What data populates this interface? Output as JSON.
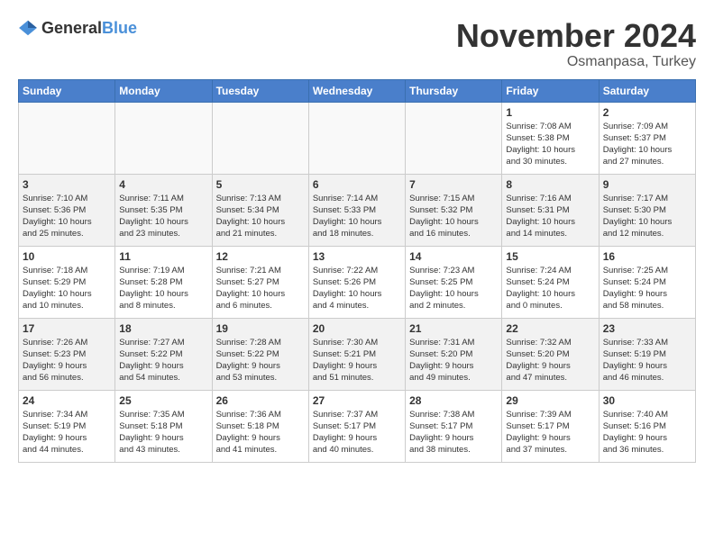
{
  "header": {
    "logo_general": "General",
    "logo_blue": "Blue",
    "month_title": "November 2024",
    "location": "Osmanpasa, Turkey"
  },
  "calendar": {
    "days_of_week": [
      "Sunday",
      "Monday",
      "Tuesday",
      "Wednesday",
      "Thursday",
      "Friday",
      "Saturday"
    ],
    "weeks": [
      [
        {
          "day": "",
          "info": ""
        },
        {
          "day": "",
          "info": ""
        },
        {
          "day": "",
          "info": ""
        },
        {
          "day": "",
          "info": ""
        },
        {
          "day": "",
          "info": ""
        },
        {
          "day": "1",
          "info": "Sunrise: 7:08 AM\nSunset: 5:38 PM\nDaylight: 10 hours\nand 30 minutes."
        },
        {
          "day": "2",
          "info": "Sunrise: 7:09 AM\nSunset: 5:37 PM\nDaylight: 10 hours\nand 27 minutes."
        }
      ],
      [
        {
          "day": "3",
          "info": "Sunrise: 7:10 AM\nSunset: 5:36 PM\nDaylight: 10 hours\nand 25 minutes."
        },
        {
          "day": "4",
          "info": "Sunrise: 7:11 AM\nSunset: 5:35 PM\nDaylight: 10 hours\nand 23 minutes."
        },
        {
          "day": "5",
          "info": "Sunrise: 7:13 AM\nSunset: 5:34 PM\nDaylight: 10 hours\nand 21 minutes."
        },
        {
          "day": "6",
          "info": "Sunrise: 7:14 AM\nSunset: 5:33 PM\nDaylight: 10 hours\nand 18 minutes."
        },
        {
          "day": "7",
          "info": "Sunrise: 7:15 AM\nSunset: 5:32 PM\nDaylight: 10 hours\nand 16 minutes."
        },
        {
          "day": "8",
          "info": "Sunrise: 7:16 AM\nSunset: 5:31 PM\nDaylight: 10 hours\nand 14 minutes."
        },
        {
          "day": "9",
          "info": "Sunrise: 7:17 AM\nSunset: 5:30 PM\nDaylight: 10 hours\nand 12 minutes."
        }
      ],
      [
        {
          "day": "10",
          "info": "Sunrise: 7:18 AM\nSunset: 5:29 PM\nDaylight: 10 hours\nand 10 minutes."
        },
        {
          "day": "11",
          "info": "Sunrise: 7:19 AM\nSunset: 5:28 PM\nDaylight: 10 hours\nand 8 minutes."
        },
        {
          "day": "12",
          "info": "Sunrise: 7:21 AM\nSunset: 5:27 PM\nDaylight: 10 hours\nand 6 minutes."
        },
        {
          "day": "13",
          "info": "Sunrise: 7:22 AM\nSunset: 5:26 PM\nDaylight: 10 hours\nand 4 minutes."
        },
        {
          "day": "14",
          "info": "Sunrise: 7:23 AM\nSunset: 5:25 PM\nDaylight: 10 hours\nand 2 minutes."
        },
        {
          "day": "15",
          "info": "Sunrise: 7:24 AM\nSunset: 5:24 PM\nDaylight: 10 hours\nand 0 minutes."
        },
        {
          "day": "16",
          "info": "Sunrise: 7:25 AM\nSunset: 5:24 PM\nDaylight: 9 hours\nand 58 minutes."
        }
      ],
      [
        {
          "day": "17",
          "info": "Sunrise: 7:26 AM\nSunset: 5:23 PM\nDaylight: 9 hours\nand 56 minutes."
        },
        {
          "day": "18",
          "info": "Sunrise: 7:27 AM\nSunset: 5:22 PM\nDaylight: 9 hours\nand 54 minutes."
        },
        {
          "day": "19",
          "info": "Sunrise: 7:28 AM\nSunset: 5:22 PM\nDaylight: 9 hours\nand 53 minutes."
        },
        {
          "day": "20",
          "info": "Sunrise: 7:30 AM\nSunset: 5:21 PM\nDaylight: 9 hours\nand 51 minutes."
        },
        {
          "day": "21",
          "info": "Sunrise: 7:31 AM\nSunset: 5:20 PM\nDaylight: 9 hours\nand 49 minutes."
        },
        {
          "day": "22",
          "info": "Sunrise: 7:32 AM\nSunset: 5:20 PM\nDaylight: 9 hours\nand 47 minutes."
        },
        {
          "day": "23",
          "info": "Sunrise: 7:33 AM\nSunset: 5:19 PM\nDaylight: 9 hours\nand 46 minutes."
        }
      ],
      [
        {
          "day": "24",
          "info": "Sunrise: 7:34 AM\nSunset: 5:19 PM\nDaylight: 9 hours\nand 44 minutes."
        },
        {
          "day": "25",
          "info": "Sunrise: 7:35 AM\nSunset: 5:18 PM\nDaylight: 9 hours\nand 43 minutes."
        },
        {
          "day": "26",
          "info": "Sunrise: 7:36 AM\nSunset: 5:18 PM\nDaylight: 9 hours\nand 41 minutes."
        },
        {
          "day": "27",
          "info": "Sunrise: 7:37 AM\nSunset: 5:17 PM\nDaylight: 9 hours\nand 40 minutes."
        },
        {
          "day": "28",
          "info": "Sunrise: 7:38 AM\nSunset: 5:17 PM\nDaylight: 9 hours\nand 38 minutes."
        },
        {
          "day": "29",
          "info": "Sunrise: 7:39 AM\nSunset: 5:17 PM\nDaylight: 9 hours\nand 37 minutes."
        },
        {
          "day": "30",
          "info": "Sunrise: 7:40 AM\nSunset: 5:16 PM\nDaylight: 9 hours\nand 36 minutes."
        }
      ]
    ]
  }
}
